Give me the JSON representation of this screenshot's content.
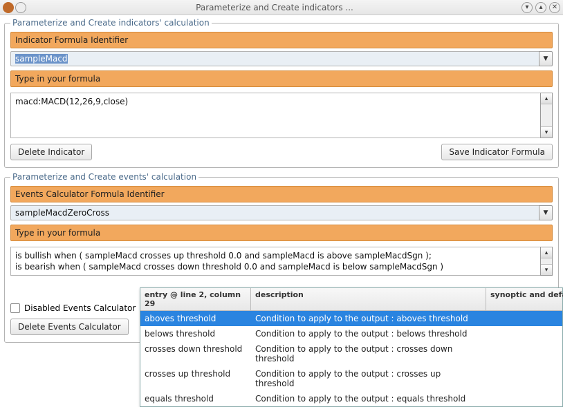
{
  "window": {
    "title": "Parameterize and Create indicators ...",
    "icons": {
      "app": "app-icon",
      "spare": "circle-icon"
    },
    "buttons": {
      "min": "▾",
      "max": "▴",
      "close": "✕"
    }
  },
  "indicators_group": {
    "legend": "Parameterize and Create indicators' calculation",
    "identifier_label": "Indicator Formula Identifier",
    "identifier_value": "sampleMacd",
    "type_label": "Type in your formula",
    "textarea_value": "macd:MACD(12,26,9,close)",
    "delete_btn": "Delete Indicator",
    "save_btn": "Save Indicator Formula"
  },
  "events_group": {
    "legend": "Parameterize and Create events' calculation",
    "identifier_label": "Events Calculator Formula Identifier",
    "identifier_value": "sampleMacdZeroCross",
    "type_label": "Type in your formula",
    "textarea_value": "is bullish when ( sampleMacd crosses up threshold 0.0 and sampleMacd is above sampleMacdSgn );\nis bearish when ( sampleMacd crosses down threshold 0.0 and sampleMacd is below sampleMacdSgn )",
    "disabled_checkbox_label": "Disabled Events Calculator",
    "disabled_checkbox_checked": false,
    "delete_btn": "Delete Events Calculator"
  },
  "autocomplete": {
    "columns": {
      "entry": "entry @ line 2, column 29",
      "description": "description",
      "synoptic": "synoptic and defaul"
    },
    "selected_index": 0,
    "rows": [
      {
        "entry": "aboves threshold",
        "desc": "Condition to apply to the output : aboves threshold"
      },
      {
        "entry": "belows threshold",
        "desc": "Condition to apply to the output : belows threshold"
      },
      {
        "entry": "crosses down threshold",
        "desc": "Condition to apply to the output : crosses down threshold"
      },
      {
        "entry": "crosses up threshold",
        "desc": "Condition to apply to the output : crosses up threshold"
      },
      {
        "entry": "equals threshold",
        "desc": "Condition to apply to the output : equals threshold"
      }
    ]
  }
}
